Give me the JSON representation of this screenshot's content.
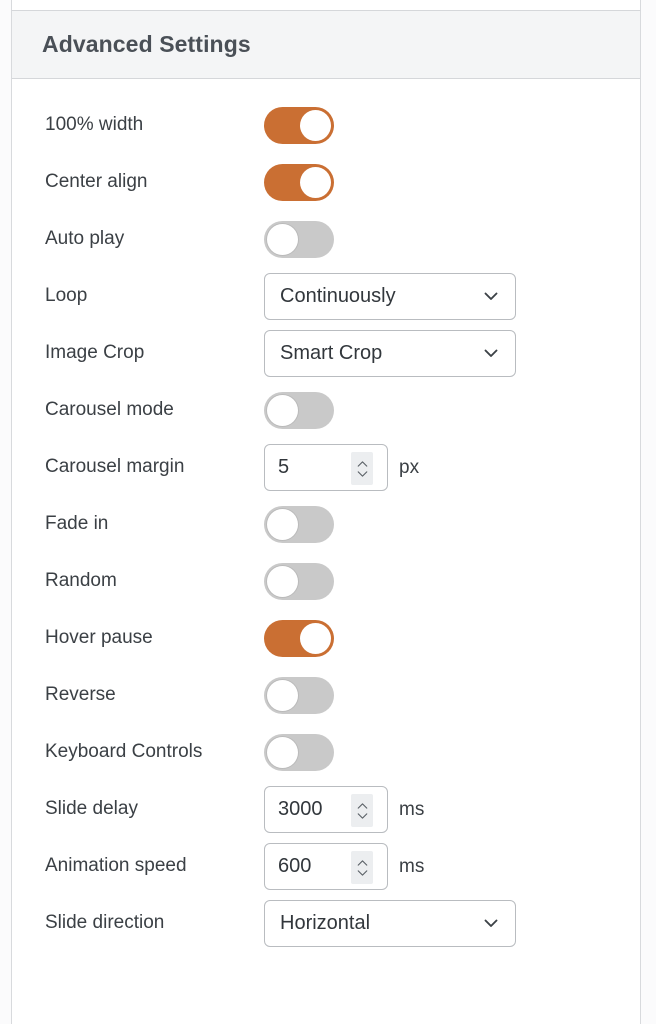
{
  "panel": {
    "header_title": "Advanced Settings",
    "accent_color": "#ca6f33",
    "toggle_off_color": "#c9c9c9",
    "header_bg": "#f4f5f6",
    "label_color": "#3b4045"
  },
  "settings": [
    {
      "label": "100% width",
      "control": "toggle",
      "state": "on",
      "name": "full-width"
    },
    {
      "label": "Center align",
      "control": "toggle",
      "state": "on",
      "name": "center-align"
    },
    {
      "label": "Auto play",
      "control": "toggle",
      "state": "off",
      "name": "auto-play"
    },
    {
      "label": "Loop",
      "control": "select",
      "value": "Continuously",
      "name": "loop"
    },
    {
      "label": "Image Crop",
      "control": "select",
      "value": "Smart Crop",
      "name": "image-crop"
    },
    {
      "label": "Carousel mode",
      "control": "toggle",
      "state": "off",
      "name": "carousel-mode"
    },
    {
      "label": "Carousel margin",
      "control": "number",
      "value": "5",
      "unit": "px",
      "name": "carousel-margin"
    },
    {
      "label": "Fade in",
      "control": "toggle",
      "state": "off",
      "name": "fade-in"
    },
    {
      "label": "Random",
      "control": "toggle",
      "state": "off",
      "name": "random"
    },
    {
      "label": "Hover pause",
      "control": "toggle",
      "state": "on",
      "name": "hover-pause"
    },
    {
      "label": "Reverse",
      "control": "toggle",
      "state": "off",
      "name": "reverse"
    },
    {
      "label": "Keyboard Controls",
      "control": "toggle",
      "state": "off",
      "name": "keyboard-controls"
    },
    {
      "label": "Slide delay",
      "control": "number",
      "value": "3000",
      "unit": "ms",
      "name": "slide-delay"
    },
    {
      "label": "Animation speed",
      "control": "number",
      "value": "600",
      "unit": "ms",
      "name": "animation-speed"
    },
    {
      "label": "Slide direction",
      "control": "select",
      "value": "Horizontal",
      "name": "slide-direction"
    }
  ],
  "icons": {
    "chevron_down": "chevron-down-icon",
    "spinner_up": "spinner-up-icon",
    "spinner_down": "spinner-down-icon"
  }
}
